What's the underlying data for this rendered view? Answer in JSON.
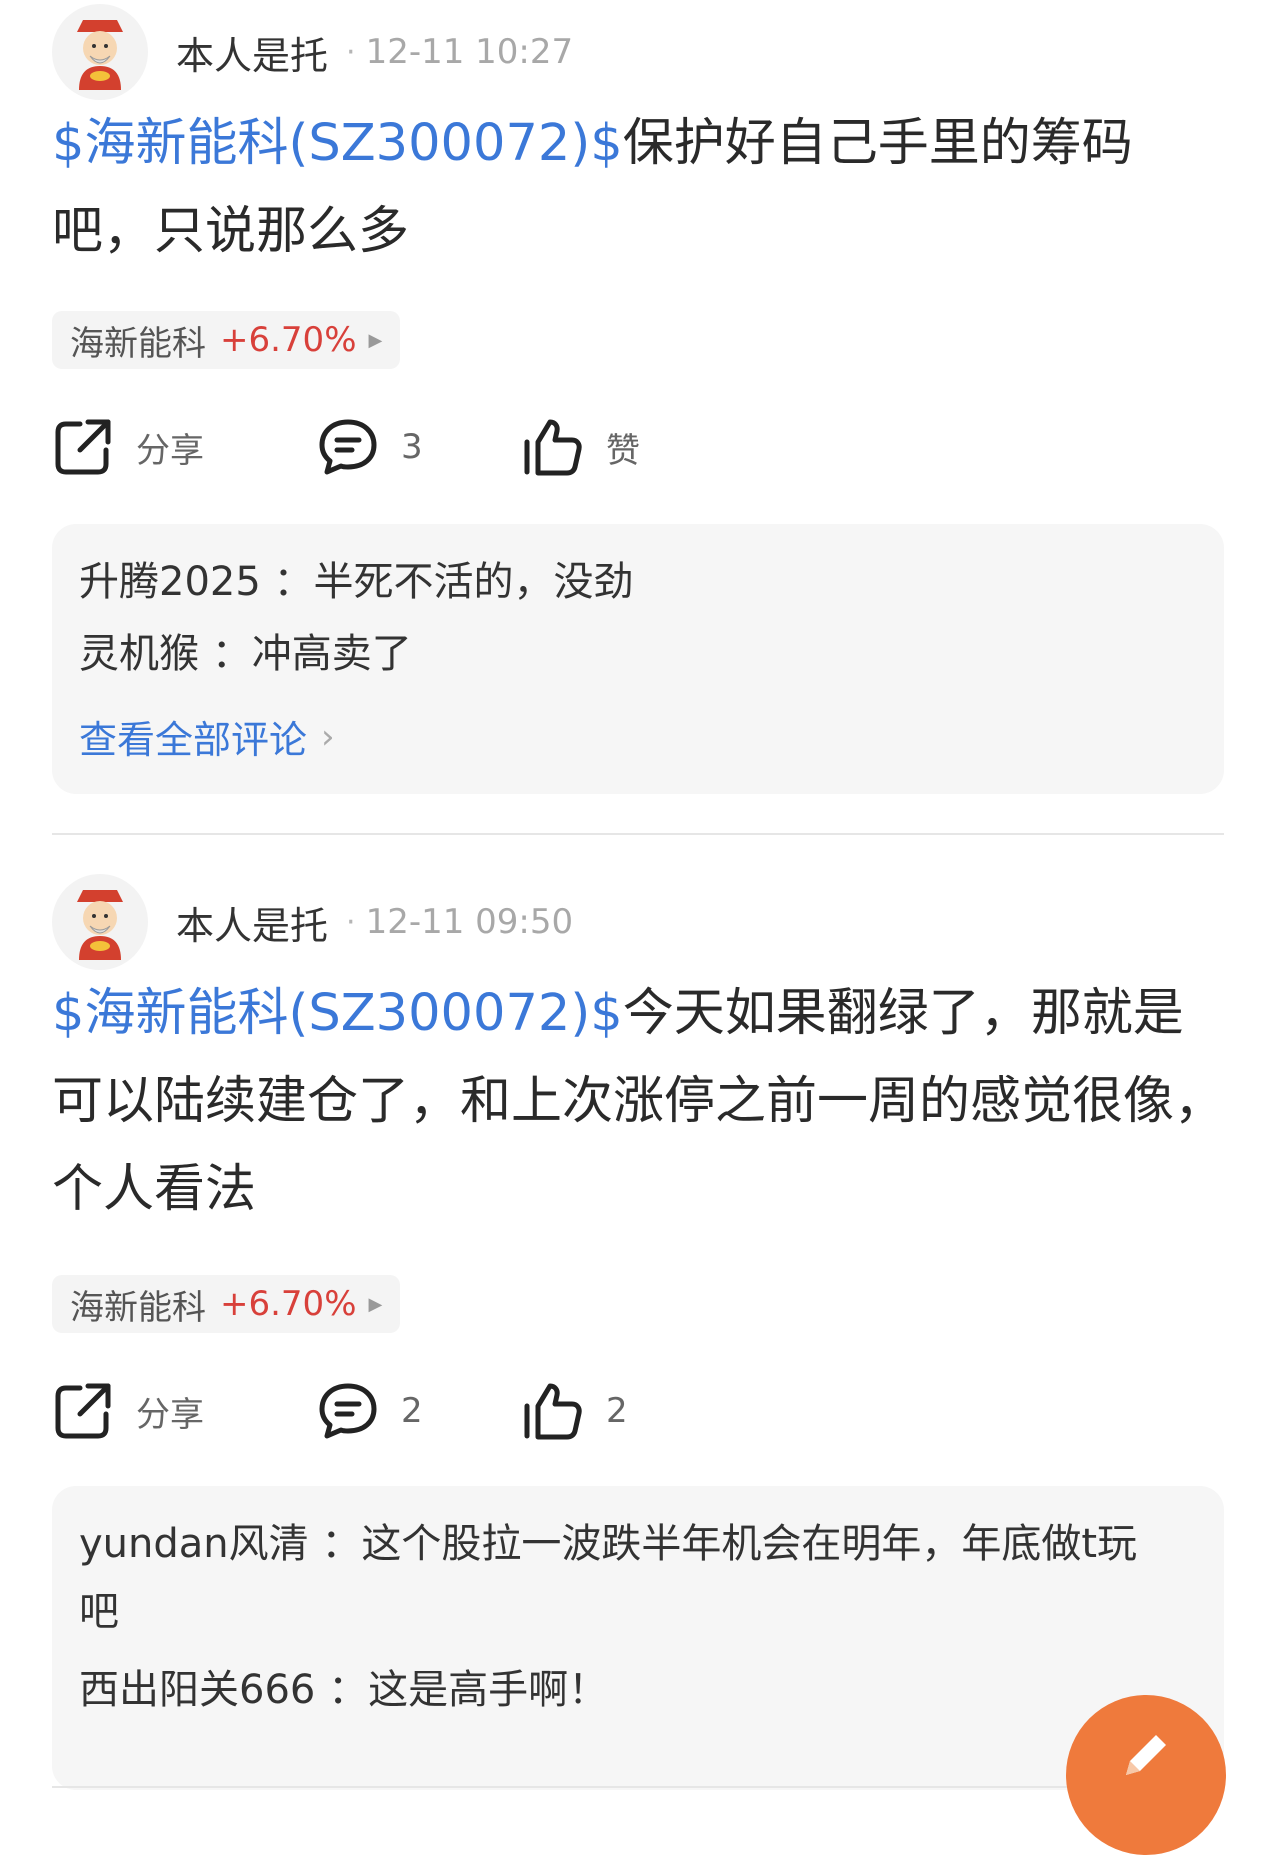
{
  "posts": [
    {
      "user": "本人是托",
      "dot": "·",
      "time": "12-11 10:27",
      "stock_tag": "$海新能科(SZ300072)$",
      "body": "保护好自己手里的筹码吧，只说那么多",
      "chip": {
        "name": "海新能科",
        "change": "+6.70%",
        "arrow": "▶"
      },
      "actions": {
        "share": "分享",
        "comments": "3",
        "like": "赞"
      },
      "comments": [
        {
          "user": "升腾2025",
          "sep": " ：",
          "text": "半死不活的，没劲"
        },
        {
          "user": "灵机猴",
          "sep": " ：",
          "text": "冲高卖了"
        }
      ],
      "view_all": "查看全部评论",
      "view_all_chevron": "›"
    },
    {
      "user": "本人是托",
      "dot": "·",
      "time": "12-11 09:50",
      "stock_tag": "$海新能科(SZ300072)$",
      "body": "今天如果翻绿了，那就是可以陆续建仓了，和上次涨停之前一周的感觉很像，个人看法",
      "chip": {
        "name": "海新能科",
        "change": "+6.70%",
        "arrow": "▶"
      },
      "actions": {
        "share": "分享",
        "comments": "2",
        "like": "2"
      },
      "comments": [
        {
          "user": "yundan风清",
          "sep": " ：",
          "text": "这个股拉一波跌半年机会在明年，年底做t玩吧"
        },
        {
          "user": "西出阳关666",
          "sep": " ：",
          "text": "这是高手啊！"
        }
      ]
    }
  ],
  "icons": {
    "avatar": "fortune-god-avatar",
    "share": "share-icon",
    "comment": "comment-icon",
    "like": "thumbs-up-icon",
    "compose": "pencil-icon"
  },
  "colors": {
    "link": "#3b78d8",
    "up": "#d8403a",
    "fab": "#ef7a3c"
  }
}
